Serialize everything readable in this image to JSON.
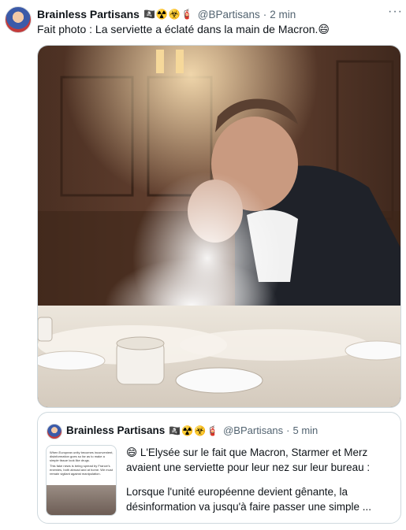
{
  "tweet": {
    "author_name": "Brainless Partisans",
    "author_emojis": "🏴‍☠️☢️☣️🧯",
    "handle": "@BPartisans",
    "separator": "·",
    "time": "2 min",
    "more": "···",
    "text": "Fait photo : La serviette a éclaté dans la main de Macron.😄"
  },
  "quoted": {
    "author_name": "Brainless Partisans",
    "author_emojis": "🏴‍☠️☢️☣️🧯",
    "handle": "@BPartisans",
    "separator": "·",
    "time": "5 min",
    "text_line1": "😄 L'Elysée sur le fait que Macron, Starmer et Merz",
    "text_line2": "avaient une serviette pour leur nez sur leur bureau :",
    "text_line3": "Lorsque l'unité européenne devient gênante, la",
    "text_line4": "désinformation va jusqu'à faire passer une simple ...",
    "thumb_text_1": "When European unity becomes inconvenient, disinformation goes so far as to make a simple tissue look like drugs.",
    "thumb_text_2": "This fake news is being spread by France's enemies, both abroad and at home. We must remain vigilant against manipulation."
  },
  "colors": {
    "text": "#0f1419",
    "secondary": "#536471",
    "border": "#cfd9de"
  }
}
